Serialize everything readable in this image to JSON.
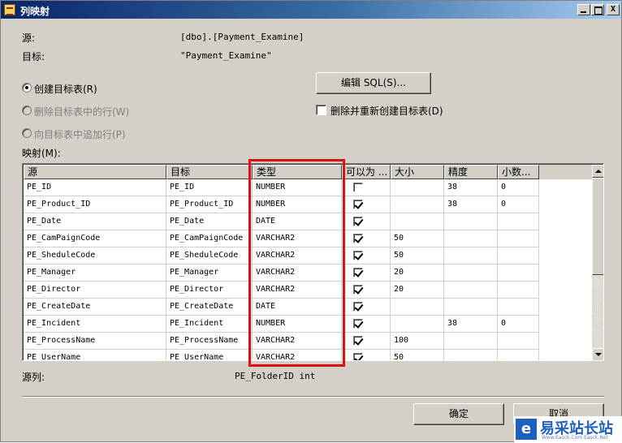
{
  "window": {
    "title": "列映射",
    "controls": {
      "minimize": "_",
      "maximize": "□",
      "close": "X"
    }
  },
  "source": {
    "label": "源:",
    "value": "[dbo].[Payment_Examine]"
  },
  "target": {
    "label": "目标:",
    "value": "\"Payment_Examine\""
  },
  "options": {
    "create_table": {
      "label": "创建目标表(R)",
      "selected": true,
      "enabled": true
    },
    "delete_rows": {
      "label": "删除目标表中的行(W)",
      "selected": false,
      "enabled": false
    },
    "append_rows": {
      "label": "向目标表中追加行(P)",
      "selected": false,
      "enabled": false
    },
    "edit_sql_button": "编辑 SQL(S)...",
    "drop_recreate": {
      "label": "删除并重新创建目标表(D)",
      "checked": false
    }
  },
  "mappings": {
    "label": "映射(M):",
    "columns": [
      "源",
      "目标",
      "类型",
      "可以为 ...",
      "大小",
      "精度",
      "小数..."
    ],
    "rows": [
      {
        "source": "PE_ID",
        "target": "PE_ID",
        "type": "NUMBER",
        "nullable": false,
        "size": "",
        "precision": "38",
        "scale": "0"
      },
      {
        "source": "PE_Product_ID",
        "target": "PE_Product_ID",
        "type": "NUMBER",
        "nullable": true,
        "size": "",
        "precision": "38",
        "scale": "0"
      },
      {
        "source": "PE_Date",
        "target": "PE_Date",
        "type": "DATE",
        "nullable": true,
        "size": "",
        "precision": "",
        "scale": ""
      },
      {
        "source": "PE_CamPaignCode",
        "target": "PE_CamPaignCode",
        "type": "VARCHAR2",
        "nullable": true,
        "size": "50",
        "precision": "",
        "scale": ""
      },
      {
        "source": "PE_SheduleCode",
        "target": "PE_SheduleCode",
        "type": "VARCHAR2",
        "nullable": true,
        "size": "50",
        "precision": "",
        "scale": ""
      },
      {
        "source": "PE_Manager",
        "target": "PE_Manager",
        "type": "VARCHAR2",
        "nullable": true,
        "size": "20",
        "precision": "",
        "scale": ""
      },
      {
        "source": "PE_Director",
        "target": "PE_Director",
        "type": "VARCHAR2",
        "nullable": true,
        "size": "20",
        "precision": "",
        "scale": ""
      },
      {
        "source": "PE_CreateDate",
        "target": "PE_CreateDate",
        "type": "DATE",
        "nullable": true,
        "size": "",
        "precision": "",
        "scale": ""
      },
      {
        "source": "PE_Incident",
        "target": "PE_Incident",
        "type": "NUMBER",
        "nullable": true,
        "size": "",
        "precision": "38",
        "scale": "0"
      },
      {
        "source": "PE_ProcessName",
        "target": "PE_ProcessName",
        "type": "VARCHAR2",
        "nullable": true,
        "size": "100",
        "precision": "",
        "scale": ""
      },
      {
        "source": "PE_UserName",
        "target": "PE_UserName",
        "type": "VARCHAR2",
        "nullable": true,
        "size": "50",
        "precision": "",
        "scale": ""
      }
    ]
  },
  "source_column": {
    "label": "源列:",
    "value": "PE_FolderID int"
  },
  "buttons": {
    "ok": "确定",
    "cancel": "取消"
  },
  "watermark": {
    "logo": "e",
    "text": "易采站长站",
    "sub": "Www.Easck.Com Easck.Net"
  },
  "colors": {
    "titlebar": "#0a246a",
    "highlight": "#e01010",
    "face": "#d4d0c8"
  }
}
